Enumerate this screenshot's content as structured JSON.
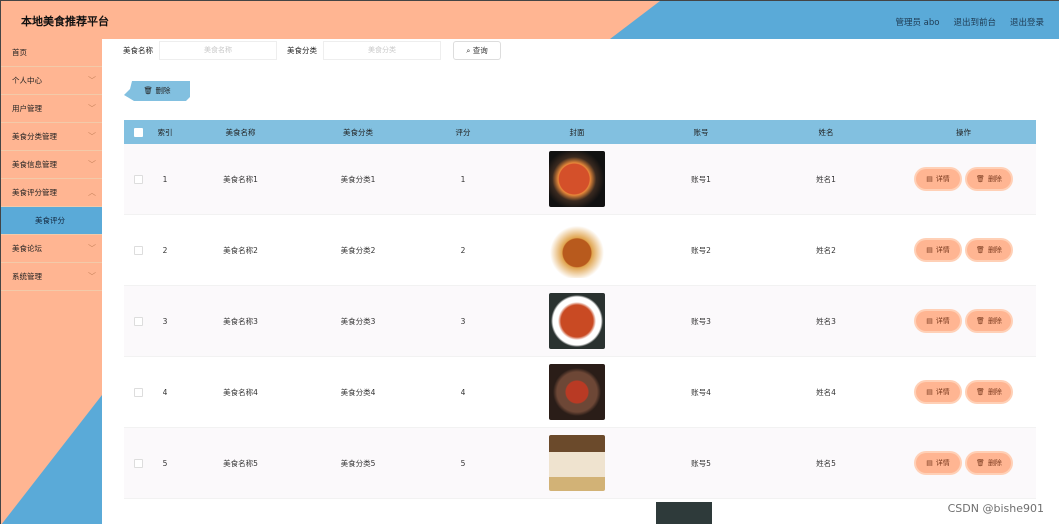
{
  "header": {
    "title": "本地美食推荐平台",
    "admin": "管理员 abo",
    "to_front": "退出到前台",
    "logout": "退出登录"
  },
  "sidebar": {
    "items": [
      {
        "label": "首页",
        "chevron": false
      },
      {
        "label": "个人中心",
        "chevron": true
      },
      {
        "label": "用户管理",
        "chevron": true
      },
      {
        "label": "美食分类管理",
        "chevron": true
      },
      {
        "label": "美食信息管理",
        "chevron": true
      },
      {
        "label": "美食评分管理",
        "chevron": true
      },
      {
        "label": "美食评分",
        "sub": true
      },
      {
        "label": "美食论坛",
        "chevron": true
      },
      {
        "label": "系统管理",
        "chevron": true
      }
    ]
  },
  "search": {
    "name_label": "美食名称",
    "name_placeholder": "美食名称",
    "category_label": "美食分类",
    "category_placeholder": "美食分类",
    "search_button": "查询"
  },
  "toolbar": {
    "delete_label": "删除"
  },
  "table": {
    "headers": [
      "索引",
      "美食名称",
      "美食分类",
      "评分",
      "封面",
      "账号",
      "姓名",
      "操作"
    ],
    "rows": [
      {
        "index": "1",
        "name": "美食名称1",
        "category": "美食分类1",
        "score": "1",
        "account": "账号1",
        "person": "姓名1"
      },
      {
        "index": "2",
        "name": "美食名称2",
        "category": "美食分类2",
        "score": "2",
        "account": "账号2",
        "person": "姓名2"
      },
      {
        "index": "3",
        "name": "美食名称3",
        "category": "美食分类3",
        "score": "3",
        "account": "账号3",
        "person": "姓名3"
      },
      {
        "index": "4",
        "name": "美食名称4",
        "category": "美食分类4",
        "score": "4",
        "account": "账号4",
        "person": "姓名4"
      },
      {
        "index": "5",
        "name": "美食名称5",
        "category": "美食分类5",
        "score": "5",
        "account": "账号5",
        "person": "姓名5"
      }
    ],
    "detail_label": "详情",
    "delete_label": "删除"
  },
  "watermark": "CSDN @bishe901",
  "colors": {
    "accent": "#ffb592",
    "blue": "#5aaad8",
    "header_row": "#82c0e0"
  }
}
